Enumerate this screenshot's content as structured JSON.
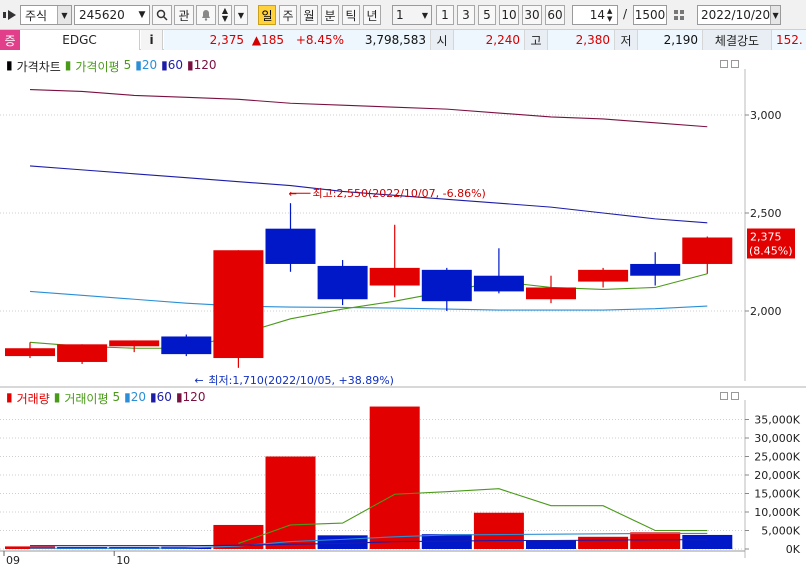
{
  "toolbar": {
    "market": "주식",
    "code": "245620",
    "btn_watch": "관",
    "periods": [
      "일",
      "주",
      "월",
      "분",
      "틱",
      "년"
    ],
    "active_period": "일",
    "interval": "1",
    "quick_intervals": [
      "1",
      "3",
      "5",
      "10",
      "30",
      "60"
    ],
    "count_visible": "14",
    "count_total": "1500",
    "date": "2022/10/20"
  },
  "quote": {
    "badge": "증",
    "name": "EDGC",
    "info_btn": "i",
    "price": "2,375",
    "change": "▲185",
    "change_pct": "+8.45%",
    "volume": "3,798,583",
    "open_label": "시",
    "open": "2,240",
    "high_label": "고",
    "high": "2,380",
    "low_label": "저",
    "low": "2,190",
    "strength_label": "체결강도",
    "strength": "152."
  },
  "price_panel": {
    "legend": {
      "title": "가격차트",
      "ma_title": "가격이평",
      "periods": [
        "5",
        "20",
        "60",
        "120"
      ],
      "colors": {
        "ma5": "#4a9a1a",
        "ma20": "#2a8fd6",
        "ma60": "#1c1ca8",
        "ma120": "#7a1040"
      }
    },
    "high_annotation": "최고:2,550(2022/10/07, -6.86%)",
    "low_annotation": "최저:1,710(2022/10/05, +38.89%)",
    "last_price_tag": "2,375",
    "last_pct_tag": "(8.45%)"
  },
  "volume_panel": {
    "legend": {
      "title": "거래량",
      "ma_title": "거래이평",
      "periods": [
        "5",
        "20",
        "60",
        "120"
      ]
    }
  },
  "x_axis": {
    "labels": [
      "09",
      "10"
    ]
  },
  "colors": {
    "up": "#e20000",
    "down": "#0018c8",
    "grid": "#cfcfcf"
  },
  "chart_data": [
    {
      "type": "candlestick",
      "title": "가격차트",
      "ylim": [
        1700,
        3250
      ],
      "y_ticks": [
        "2,000",
        "2,500",
        "3,000"
      ],
      "candles": [
        {
          "open": 1770,
          "high": 1840,
          "low": 1760,
          "close": 1810,
          "dir": "up"
        },
        {
          "open": 1740,
          "high": 1830,
          "low": 1730,
          "close": 1830,
          "dir": "up"
        },
        {
          "open": 1820,
          "high": 1850,
          "low": 1790,
          "close": 1850,
          "dir": "up"
        },
        {
          "open": 1870,
          "high": 1880,
          "low": 1770,
          "close": 1780,
          "dir": "down"
        },
        {
          "open": 1760,
          "high": 2310,
          "low": 1710,
          "close": 2310,
          "dir": "up"
        },
        {
          "open": 2420,
          "high": 2550,
          "low": 2200,
          "close": 2240,
          "dir": "down"
        },
        {
          "open": 2230,
          "high": 2260,
          "low": 2030,
          "close": 2060,
          "dir": "down"
        },
        {
          "open": 2130,
          "high": 2440,
          "low": 2070,
          "close": 2220,
          "dir": "up"
        },
        {
          "open": 2210,
          "high": 2220,
          "low": 2000,
          "close": 2050,
          "dir": "down"
        },
        {
          "open": 2180,
          "high": 2320,
          "low": 2090,
          "close": 2100,
          "dir": "down"
        },
        {
          "open": 2060,
          "high": 2180,
          "low": 2040,
          "close": 2120,
          "dir": "up"
        },
        {
          "open": 2150,
          "high": 2220,
          "low": 2120,
          "close": 2210,
          "dir": "up"
        },
        {
          "open": 2240,
          "high": 2300,
          "low": 2130,
          "close": 2180,
          "dir": "down"
        },
        {
          "open": 2240,
          "high": 2380,
          "low": 2190,
          "close": 2375,
          "dir": "up"
        }
      ],
      "series": [
        {
          "name": "5",
          "values": [
            1840,
            1820,
            1810,
            1810,
            1880,
            1960,
            2010,
            2050,
            2100,
            2150,
            2120,
            2110,
            2120,
            2190
          ]
        },
        {
          "name": "20",
          "values": [
            2100,
            2080,
            2060,
            2040,
            2025,
            2020,
            2018,
            2015,
            2010,
            2005,
            2005,
            2005,
            2012,
            2025
          ]
        },
        {
          "name": "60",
          "values": [
            2740,
            2720,
            2700,
            2680,
            2660,
            2640,
            2610,
            2590,
            2570,
            2550,
            2530,
            2500,
            2470,
            2450
          ]
        },
        {
          "name": "120",
          "values": [
            3130,
            3120,
            3100,
            3090,
            3080,
            3060,
            3050,
            3040,
            3030,
            3010,
            2990,
            2980,
            2960,
            2940
          ]
        }
      ]
    },
    {
      "type": "bar",
      "title": "거래량",
      "ylim": [
        0,
        40000
      ],
      "y_unit": "K",
      "y_ticks": [
        "0K",
        "5,000K",
        "10,000K",
        "15,000K",
        "20,000K",
        "25,000K",
        "30,000K",
        "35,000K"
      ],
      "values": [
        700,
        300,
        300,
        600,
        6500,
        25000,
        3700,
        38500,
        4000,
        9800,
        2300,
        3300,
        4500,
        3800
      ],
      "dirs": [
        "up",
        "down",
        "down",
        "down",
        "up",
        "up",
        "down",
        "up",
        "down",
        "up",
        "down",
        "up",
        "up",
        "down"
      ],
      "series": [
        {
          "name": "5",
          "values": [
            null,
            null,
            null,
            null,
            1500,
            6500,
            7000,
            14800,
            15500,
            16300,
            11700,
            11700,
            5000,
            5000
          ]
        },
        {
          "name": "20",
          "values": [
            200,
            200,
            200,
            300,
            800,
            2000,
            2600,
            3300,
            3800,
            3900,
            4000,
            4100,
            4200,
            4200
          ]
        },
        {
          "name": "60",
          "values": [
            900,
            900,
            900,
            900,
            1000,
            1300,
            1500,
            2000,
            2100,
            2300,
            2300,
            2400,
            2500,
            2500
          ]
        }
      ]
    }
  ]
}
